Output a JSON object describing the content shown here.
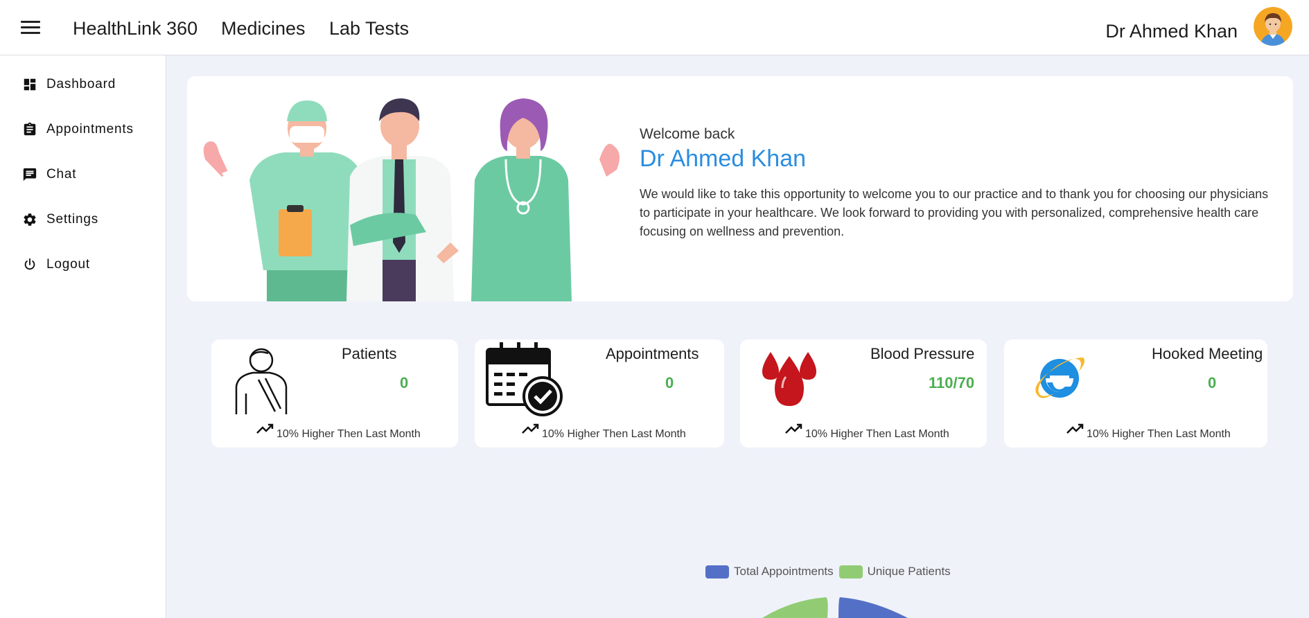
{
  "topbar": {
    "brand": "HealthLink 360",
    "nav": [
      "Medicines",
      "Lab Tests"
    ],
    "user_name": "Dr Ahmed Khan"
  },
  "sidebar": {
    "items": [
      {
        "label": "Dashboard",
        "icon": "dashboard-icon"
      },
      {
        "label": "Appointments",
        "icon": "clipboard-icon"
      },
      {
        "label": "Chat",
        "icon": "chat-icon"
      },
      {
        "label": "Settings",
        "icon": "gear-icon"
      },
      {
        "label": "Logout",
        "icon": "power-icon"
      }
    ]
  },
  "welcome": {
    "subtitle": "Welcome back",
    "name": "Dr Ahmed Khan",
    "message": "We would like to take this opportunity to welcome you to our practice and to thank you for choosing our physicians to participate in your healthcare. We look forward to providing you with personalized, comprehensive health care focusing on wellness and prevention."
  },
  "stats": [
    {
      "title": "Patients",
      "value": "0",
      "footer": "10% Higher Then Last Month",
      "icon": "patient-icon"
    },
    {
      "title": "Appointments",
      "value": "0",
      "footer": "10% Higher Then Last Month",
      "icon": "calendar-check-icon"
    },
    {
      "title": "Blood Pressure",
      "value": "110/70",
      "footer": "10% Higher Then Last Month",
      "icon": "blood-drops-icon"
    },
    {
      "title": "Hooked Meeting",
      "value": "0",
      "footer": "10% Higher Then Last Month",
      "icon": "browser-e-icon"
    }
  ],
  "chart_data": {
    "type": "pie",
    "series": [
      {
        "name": "Total Appointments",
        "color": "#5470c6"
      },
      {
        "name": "Unique Patients",
        "color": "#91cc75"
      }
    ]
  },
  "colors": {
    "accent": "#2a8de0",
    "value_green": "#4caf50",
    "background": "#f0f2fa"
  }
}
